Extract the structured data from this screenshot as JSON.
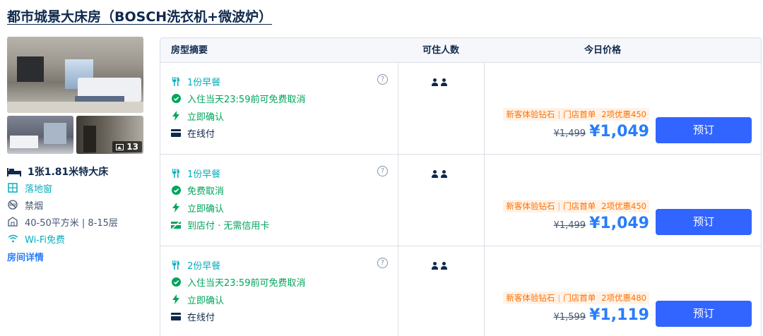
{
  "room_title": "都市城景大床房（BOSCH洗衣机+微波炉）",
  "gallery": {
    "photo_count": "13"
  },
  "room_features": [
    {
      "icon": "bed-icon",
      "label": "1张1.81米特大床"
    },
    {
      "icon": "window-icon",
      "label": "落地窗"
    },
    {
      "icon": "no-smoking-icon",
      "label": "禁烟"
    },
    {
      "icon": "area-icon",
      "label": "40-50平方米 | 8-15层"
    },
    {
      "icon": "wifi-icon",
      "label": "Wi-Fi免费"
    }
  ],
  "room_details_link": "房间详情",
  "table": {
    "headers": {
      "type": "房型摘要",
      "capacity": "可住人数",
      "price": "今日价格"
    },
    "rows": [
      {
        "benefits": [
          {
            "icon": "utensils-icon",
            "label": "1份早餐",
            "color": "#06aebd"
          },
          {
            "icon": "check-circle-icon",
            "label": "入住当天23:59前可免费取消",
            "color": "#00a45b"
          },
          {
            "icon": "lightning-icon",
            "label": "立即确认",
            "color": "#00a45b"
          },
          {
            "icon": "credit-card-icon",
            "label": "在线付",
            "color": "#0f294d"
          }
        ],
        "promo": {
          "a": "新客体验钻石",
          "b": "门店首单",
          "c": "2项优惠450"
        },
        "old_price": "¥1,499",
        "new_price": "¥1,049",
        "book_label": "预订"
      },
      {
        "benefits": [
          {
            "icon": "utensils-icon",
            "label": "1份早餐",
            "color": "#06aebd"
          },
          {
            "icon": "check-circle-icon",
            "label": "免费取消",
            "color": "#00a45b"
          },
          {
            "icon": "lightning-icon",
            "label": "立即确认",
            "color": "#00a45b"
          },
          {
            "icon": "no-card-icon",
            "label": "到店付 · 无需信用卡",
            "color": "#00a45b"
          }
        ],
        "promo": {
          "a": "新客体验钻石",
          "b": "门店首单",
          "c": "2项优惠450"
        },
        "old_price": "¥1,499",
        "new_price": "¥1,049",
        "book_label": "预订"
      },
      {
        "benefits": [
          {
            "icon": "utensils-icon",
            "label": "2份早餐",
            "color": "#06aebd"
          },
          {
            "icon": "check-circle-icon",
            "label": "入住当天23:59前可免费取消",
            "color": "#00a45b"
          },
          {
            "icon": "lightning-icon",
            "label": "立即确认",
            "color": "#00a45b"
          },
          {
            "icon": "credit-card-icon",
            "label": "在线付",
            "color": "#0f294d"
          }
        ],
        "promo": {
          "a": "新客体验钻石",
          "b": "门店首单",
          "c": "2项优惠480"
        },
        "old_price": "¥1,599",
        "new_price": "¥1,119",
        "book_label": "预订"
      }
    ]
  },
  "colors": {
    "accent": "#287dfa",
    "button": "#3264ff",
    "promo": "#ff6f00",
    "teal": "#06aebd",
    "green": "#00a45b"
  }
}
